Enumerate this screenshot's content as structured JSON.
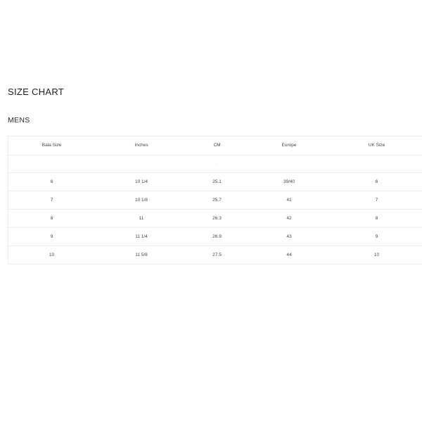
{
  "page": {
    "title": "SIZE CHART",
    "section": "MENS"
  },
  "table": {
    "headers": [
      "Bala Size",
      "Inches",
      "CM",
      "Europe",
      "UK Size"
    ],
    "spacer_mark": "·",
    "rows": [
      [
        "6",
        "10 1/4",
        "25.1",
        "39/40",
        "6"
      ],
      [
        "7",
        "10 1/8",
        "25.7",
        "41",
        "7"
      ],
      [
        "8",
        "11",
        "26.3",
        "42",
        "8"
      ],
      [
        "9",
        "11 1/4",
        "26.9",
        "43",
        "9"
      ],
      [
        "10",
        "11 5/8",
        "27.5",
        "44",
        "10"
      ]
    ]
  }
}
